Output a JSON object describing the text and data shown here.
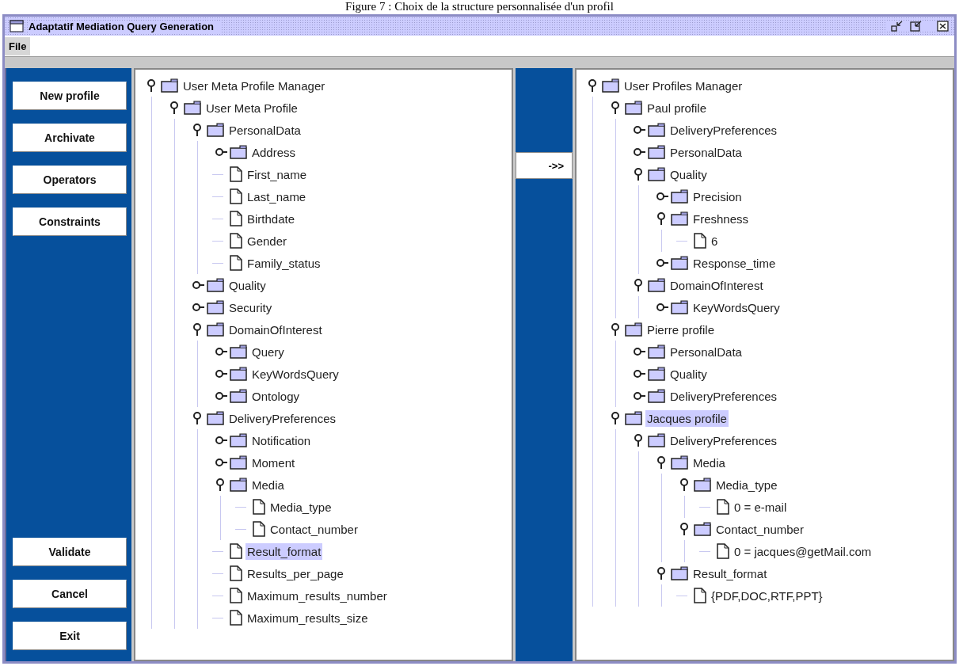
{
  "caption": "Figure 7 : Choix de la structure personnalisée d'un profil",
  "window": {
    "title": "Adaptatif Mediation Query Generation"
  },
  "menu": [
    "File"
  ],
  "side_buttons_top": [
    "New profile",
    "Archivate",
    "Operators",
    "Constraints"
  ],
  "side_buttons_bottom": [
    "Validate",
    "Cancel",
    "Exit"
  ],
  "transfer_button": "->>",
  "left_tree": {
    "label": "User Meta Profile Manager",
    "kind": "folder",
    "expanded": true,
    "selected": false,
    "children": [
      {
        "label": "User Meta Profile",
        "kind": "folder",
        "expanded": true,
        "selected": false,
        "children": [
          {
            "label": "PersonalData",
            "kind": "folder",
            "expanded": true,
            "selected": false,
            "children": [
              {
                "label": "Address",
                "kind": "folder",
                "expanded": false,
                "selected": false
              },
              {
                "label": "First_name",
                "kind": "file",
                "selected": false
              },
              {
                "label": "Last_name",
                "kind": "file",
                "selected": false
              },
              {
                "label": "Birthdate",
                "kind": "file",
                "selected": false
              },
              {
                "label": "Gender",
                "kind": "file",
                "selected": false
              },
              {
                "label": "Family_status",
                "kind": "file",
                "selected": false
              }
            ]
          },
          {
            "label": "Quality",
            "kind": "folder",
            "expanded": false,
            "selected": false
          },
          {
            "label": "Security",
            "kind": "folder",
            "expanded": false,
            "selected": false
          },
          {
            "label": "DomainOfInterest",
            "kind": "folder",
            "expanded": true,
            "selected": false,
            "children": [
              {
                "label": "Query",
                "kind": "folder",
                "expanded": false,
                "selected": false
              },
              {
                "label": "KeyWordsQuery",
                "kind": "folder",
                "expanded": false,
                "selected": false
              },
              {
                "label": "Ontology",
                "kind": "folder",
                "expanded": false,
                "selected": false
              }
            ]
          },
          {
            "label": "DeliveryPreferences",
            "kind": "folder",
            "expanded": true,
            "selected": false,
            "children": [
              {
                "label": "Notification",
                "kind": "folder",
                "expanded": false,
                "selected": false
              },
              {
                "label": "Moment",
                "kind": "folder",
                "expanded": false,
                "selected": false
              },
              {
                "label": "Media",
                "kind": "folder",
                "expanded": true,
                "selected": false,
                "children": [
                  {
                    "label": "Media_type",
                    "kind": "file",
                    "selected": false
                  },
                  {
                    "label": "Contact_number",
                    "kind": "file",
                    "selected": false
                  }
                ]
              },
              {
                "label": "Result_format",
                "kind": "file",
                "selected": true
              },
              {
                "label": "Results_per_page",
                "kind": "file",
                "selected": false
              },
              {
                "label": "Maximum_results_number",
                "kind": "file",
                "selected": false
              },
              {
                "label": "Maximum_results_size",
                "kind": "file",
                "selected": false
              }
            ]
          }
        ]
      }
    ]
  },
  "right_tree": {
    "label": "User Profiles Manager",
    "kind": "folder",
    "expanded": true,
    "selected": false,
    "children": [
      {
        "label": "Paul profile",
        "kind": "folder",
        "expanded": true,
        "selected": false,
        "children": [
          {
            "label": "DeliveryPreferences",
            "kind": "folder",
            "expanded": false,
            "selected": false
          },
          {
            "label": "PersonalData",
            "kind": "folder",
            "expanded": false,
            "selected": false
          },
          {
            "label": "Quality",
            "kind": "folder",
            "expanded": true,
            "selected": false,
            "children": [
              {
                "label": "Precision",
                "kind": "folder",
                "expanded": false,
                "selected": false
              },
              {
                "label": "Freshness",
                "kind": "folder",
                "expanded": true,
                "selected": false,
                "children": [
                  {
                    "label": "6",
                    "kind": "file",
                    "selected": false
                  }
                ]
              },
              {
                "label": "Response_time",
                "kind": "folder",
                "expanded": false,
                "selected": false
              }
            ]
          },
          {
            "label": "DomainOfInterest",
            "kind": "folder",
            "expanded": true,
            "selected": false,
            "children": [
              {
                "label": "KeyWordsQuery",
                "kind": "folder",
                "expanded": false,
                "selected": false
              }
            ]
          }
        ]
      },
      {
        "label": "Pierre profile",
        "kind": "folder",
        "expanded": true,
        "selected": false,
        "children": [
          {
            "label": "PersonalData",
            "kind": "folder",
            "expanded": false,
            "selected": false
          },
          {
            "label": "Quality",
            "kind": "folder",
            "expanded": false,
            "selected": false
          },
          {
            "label": "DeliveryPreferences",
            "kind": "folder",
            "expanded": false,
            "selected": false
          }
        ]
      },
      {
        "label": "Jacques profile",
        "kind": "folder",
        "expanded": true,
        "selected": true,
        "children": [
          {
            "label": "DeliveryPreferences",
            "kind": "folder",
            "expanded": true,
            "selected": false,
            "children": [
              {
                "label": "Media",
                "kind": "folder",
                "expanded": true,
                "selected": false,
                "children": [
                  {
                    "label": "Media_type",
                    "kind": "folder",
                    "expanded": true,
                    "selected": false,
                    "children": [
                      {
                        "label": "0 = e-mail",
                        "kind": "file",
                        "selected": false
                      }
                    ]
                  },
                  {
                    "label": "Contact_number",
                    "kind": "folder",
                    "expanded": true,
                    "selected": false,
                    "children": [
                      {
                        "label": "0 = jacques@getMail.com",
                        "kind": "file",
                        "selected": false
                      }
                    ]
                  }
                ]
              },
              {
                "label": "Result_format",
                "kind": "folder",
                "expanded": true,
                "selected": false,
                "children": [
                  {
                    "label": "{PDF,DOC,RTF,PPT}",
                    "kind": "file",
                    "selected": false
                  }
                ]
              }
            ]
          }
        ]
      }
    ]
  }
}
